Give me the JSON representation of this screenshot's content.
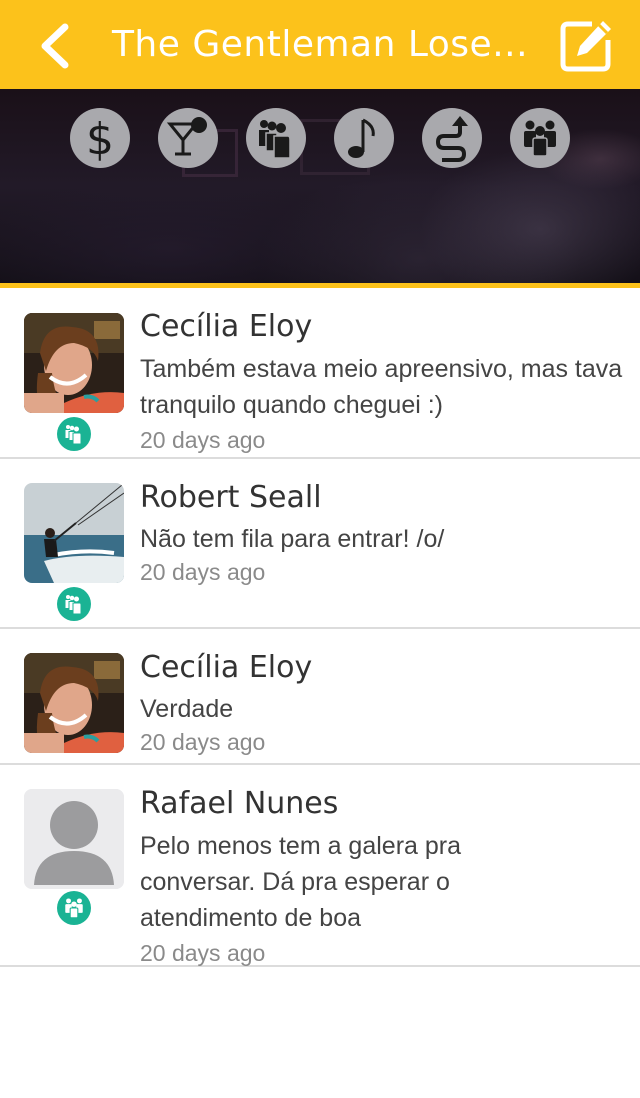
{
  "header": {
    "title": "The Gentleman Lose...",
    "back_icon": "chevron-left-icon",
    "edit_icon": "compose-icon",
    "background_color": "#fcc21b"
  },
  "categories": [
    {
      "icon": "dollar-icon"
    },
    {
      "icon": "cocktail-icon"
    },
    {
      "icon": "queue-icon"
    },
    {
      "icon": "music-note-icon"
    },
    {
      "icon": "route-icon"
    },
    {
      "icon": "crowd-icon"
    }
  ],
  "comments": [
    {
      "name": "Cecília Eloy",
      "message": "Também estava meio apreensivo, mas tava tranquilo quando cheguei :)",
      "time": "20 days ago",
      "badge_icon": "queue-badge-icon",
      "avatar": "photo-woman"
    },
    {
      "name": "Robert Seall",
      "message": "Não tem fila para entrar! /o/",
      "time": "20 days ago",
      "badge_icon": "queue-badge-icon",
      "avatar": "photo-kitesurf"
    },
    {
      "name": "Cecília Eloy",
      "message": "Verdade",
      "time": "20 days ago",
      "badge_icon": "queue-badge-icon",
      "avatar": "photo-woman"
    },
    {
      "name": "Rafael Nunes",
      "message": "Pelo menos tem a galera pra conversar. Dá pra esperar o atendimento de boa",
      "time": "20 days ago",
      "badge_icon": "crowd-badge-icon",
      "avatar": "placeholder-person"
    }
  ],
  "colors": {
    "accent": "#fcc21b",
    "badge": "#1ab394",
    "category_icon": "#a9a9ad"
  }
}
